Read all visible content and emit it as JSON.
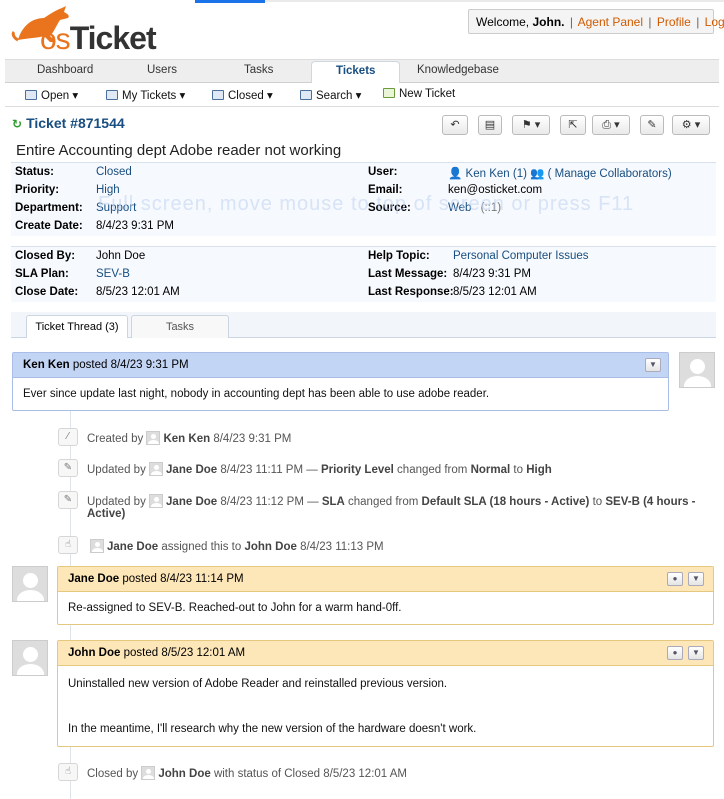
{
  "header": {
    "logo_text_os": "os",
    "logo_text_ticket": "Ticket",
    "welcome_prefix": "Welcome,",
    "welcome_user": "John.",
    "links": [
      "Agent Panel",
      "Profile",
      "Log Out"
    ]
  },
  "nav": {
    "tabs": [
      "Dashboard",
      "Users",
      "Tasks",
      "Tickets",
      "Knowledgebase"
    ],
    "active": "Tickets"
  },
  "subnav": {
    "items": [
      "Open",
      "My Tickets",
      "Closed",
      "Search",
      "New Ticket"
    ]
  },
  "ticket": {
    "title": "Ticket #871544",
    "subject": "Entire Accounting dept Adobe reader not working",
    "watermark": "Full screen, move mouse to top of screen or press F11"
  },
  "info1": {
    "status_label": "Status:",
    "status": "Closed",
    "priority_label": "Priority:",
    "priority": "High",
    "department_label": "Department:",
    "department": "Support",
    "create_date_label": "Create Date:",
    "create_date": "8/4/23 9:31 PM",
    "user_label": "User:",
    "user": "Ken Ken",
    "user_count": "(1)",
    "manage_collaborators": "( Manage Collaborators)",
    "email_label": "Email:",
    "email": "ken@osticket.com",
    "source_label": "Source:",
    "source": "Web",
    "source_ip": "(::1)"
  },
  "info2": {
    "closed_by_label": "Closed By:",
    "closed_by": "John Doe",
    "sla_label": "SLA Plan:",
    "sla": "SEV-B",
    "close_date_label": "Close Date:",
    "close_date": "8/5/23 12:01 AM",
    "help_topic_label": "Help Topic:",
    "help_topic": "Personal Computer Issues",
    "last_message_label": "Last Message:",
    "last_message": "8/4/23 9:31 PM",
    "last_response_label": "Last Response:",
    "last_response": "8/5/23 12:01 AM"
  },
  "thread_tabs": [
    "Ticket Thread (3)",
    "Tasks"
  ],
  "thread": {
    "entry1": {
      "author": "Ken Ken",
      "posted": "posted 8/4/23 9:31 PM",
      "body": "Ever since update last night, nobody in accounting dept has been able to use adobe reader."
    },
    "event1": {
      "prefix": "Created by",
      "who": "Ken Ken",
      "when": "8/4/23 9:31 PM"
    },
    "event2": {
      "prefix": "Updated by",
      "who": "Jane Doe",
      "when": "8/4/23 11:11 PM —",
      "field": "Priority Level",
      "changed": "changed from",
      "from": "Normal",
      "to_word": "to",
      "to": "High"
    },
    "event3": {
      "prefix": "Updated by",
      "who": "Jane Doe",
      "when": "8/4/23 11:12 PM —",
      "field": "SLA",
      "changed": "changed from",
      "from": "Default SLA (18 hours - Active)",
      "to_word": "to",
      "to": "SEV-B (4 hours -",
      "to_cont": "Active)"
    },
    "event4": {
      "who": "Jane Doe",
      "action": "assigned this to",
      "target": "John Doe",
      "when": "8/4/23 11:13 PM"
    },
    "entry2": {
      "author": "Jane Doe",
      "posted": "posted 8/4/23 11:14 PM",
      "body": "Re-assigned to SEV-B. Reached-out to John for a warm hand-0ff."
    },
    "entry3": {
      "author": "John Doe",
      "posted": "posted 8/5/23 12:01 AM",
      "body1": "Uninstalled new version of Adobe Reader and reinstalled previous version.",
      "body2": "In the meantime, I'll research why the new version of the hardware doesn't work."
    },
    "event5": {
      "prefix": "Closed by",
      "who": "John Doe",
      "suffix": "with status of Closed 8/5/23 12:01 AM"
    }
  },
  "colors": {
    "brand": "#184E81",
    "accent_orange": "#e9741d",
    "user_header": "#c3d5f5",
    "staff_header": "#fde6b8"
  }
}
